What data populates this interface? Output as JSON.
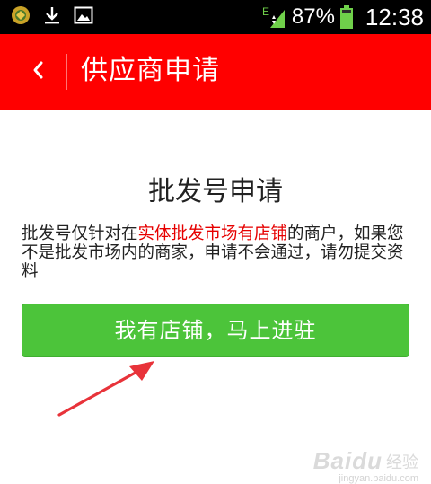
{
  "status_bar": {
    "battery_percent": "87%",
    "time": "12:38",
    "network_label": "E",
    "icons": [
      "app-notification-icon",
      "download-icon",
      "image-icon",
      "signal-icon",
      "battery-icon"
    ]
  },
  "header": {
    "title": "供应商申请",
    "back_icon": "chevron-left-icon",
    "background_color": "#ff0000"
  },
  "content": {
    "title": "批发号申请",
    "description_prefix": "批发号仅针对在",
    "description_highlight": "实体批发市场有店铺",
    "description_suffix": "的商户，如果您不是批发市场内的商家，申请不会通过，请勿提交资料",
    "join_button_label": "我有店铺，马上进驻",
    "accent_color": "#4cc43a",
    "highlight_color": "#e60000"
  },
  "watermark": {
    "brand": "Baidu",
    "text": "经验",
    "url": "jingyan.baidu.com"
  }
}
